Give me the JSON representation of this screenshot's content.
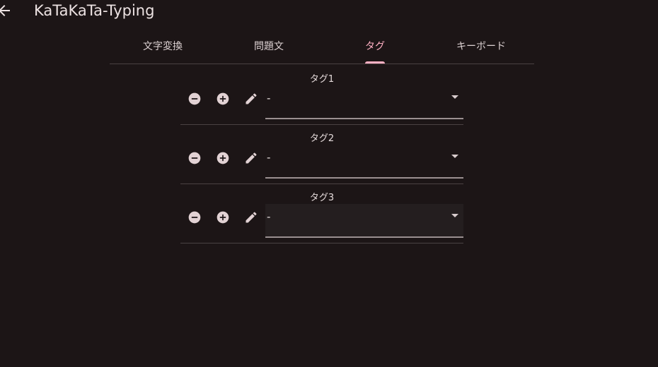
{
  "app": {
    "title": "KaTaKaTa-Typing"
  },
  "tabs": [
    {
      "label": "文字変換",
      "active": false
    },
    {
      "label": "問題文",
      "active": false
    },
    {
      "label": "タグ",
      "active": true
    },
    {
      "label": "キーボード",
      "active": false
    }
  ],
  "tags": [
    {
      "label": "タグ1",
      "value": "-"
    },
    {
      "label": "タグ2",
      "value": "-"
    },
    {
      "label": "タグ3",
      "value": "-"
    }
  ],
  "icons": {
    "back": "arrow-back-icon",
    "remove": "remove-circle-icon",
    "add": "add-circle-icon",
    "edit": "pencil-icon",
    "dropdown": "dropdown-arrow-icon"
  },
  "colors": {
    "background": "#1c1516",
    "accent": "#ffb0c4",
    "icon_fill": "#e2d2d4",
    "divider": "#4a4243"
  }
}
